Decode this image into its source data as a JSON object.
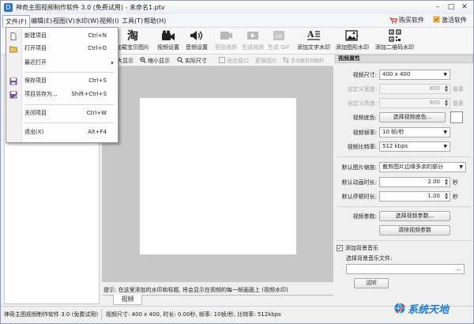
{
  "window": {
    "title": "神奇主图视频制作软件 3.0 (免费试用) - 未命名1.ptv",
    "controls": [
      "–",
      "□",
      "✕"
    ]
  },
  "menubar": {
    "items": [
      "文件(F)",
      "编辑(E)",
      "视图(V)",
      "水印(W)",
      "视频(I)",
      "工具(T)",
      "帮助(H)"
    ],
    "buy_label": "购买软件",
    "activate_label": "激活软件"
  },
  "toolbar": {
    "items": [
      {
        "label": "加载宝贝图片",
        "icon": "taobao-icon"
      },
      {
        "label": "视频设置",
        "icon": "video-camera-icon"
      },
      {
        "label": "音频设置",
        "icon": "speaker-icon"
      },
      {
        "label": "预览视频",
        "icon": "preview-video-icon"
      },
      {
        "label": "生成视频",
        "icon": "generate-video-icon"
      },
      {
        "label": "生成 GIF",
        "icon": "gif-icon"
      },
      {
        "label": "添加文字水印",
        "icon": "text-watermark-icon"
      },
      {
        "label": "添加图形水印",
        "icon": "image-watermark-icon"
      },
      {
        "label": "添加二维码水印",
        "icon": "qrcode-icon"
      }
    ]
  },
  "subtoolbar": {
    "items": [
      "放大显示",
      "缩小显示",
      "实际尺寸",
      "适合窗口",
      "更换图片",
      "手动裁剪和翻转"
    ]
  },
  "file_menu": {
    "items": [
      {
        "label": "新建项目",
        "shortcut": "Ctrl+N",
        "icon": "new-file-icon"
      },
      {
        "label": "打开项目",
        "shortcut": "Ctrl+O",
        "icon": "open-folder-icon"
      },
      {
        "label": "最近打开",
        "shortcut": "",
        "icon": "",
        "submenu": "▸"
      },
      {
        "label": "保存项目",
        "shortcut": "Ctrl+S",
        "icon": "save-icon"
      },
      {
        "label": "项目另存为...",
        "shortcut": "Shift+Ctrl+S",
        "icon": "save-as-icon"
      },
      {
        "label": "关闭项目",
        "shortcut": "Ctrl+W",
        "icon": ""
      },
      {
        "label": "退出(X)",
        "shortcut": "Alt+F4",
        "icon": ""
      }
    ]
  },
  "canvas": {
    "hint": "提示: 在这里添加的水印和标题, 将会显示在视频的每一帧画面上 (视频水印)",
    "tab": "视频"
  },
  "properties": {
    "header": "视频属性",
    "video_size": {
      "label": "视频尺寸:",
      "value": "400 x 400"
    },
    "custom_width": {
      "label": "自定义宽度:",
      "value": "800",
      "unit": "像素"
    },
    "custom_height": {
      "label": "自定义高度:",
      "value": "800",
      "unit": "像素"
    },
    "bg_color": {
      "label": "视频底色:",
      "button": "选择视频底色..."
    },
    "frame_rate": {
      "label": "视频帧率:",
      "value": "10 帧/秒"
    },
    "bitrate": {
      "label": "视频比特率:",
      "value": "512 kbps"
    },
    "image_scale": {
      "label": "默认图片缩放:",
      "value": "裁剪图片边缘多余的部分"
    },
    "anim_duration": {
      "label": "默认动画时长:",
      "value": "2.00",
      "unit": "秒"
    },
    "pause_duration": {
      "label": "默认停顿时长:",
      "value": "1.00",
      "unit": "秒"
    },
    "video_params": {
      "label": "视频参数:",
      "button": "选择视频参数...",
      "clear_button": "清除视频参数"
    },
    "music": {
      "checkbox": "添加背景音乐",
      "checked": true,
      "file_label": "选择背景音乐文件:",
      "browse": "...",
      "test_button": "试听"
    }
  },
  "status": {
    "left": "神奇主图视频制作软件 3.0 (免费试用)",
    "right": "视频尺寸: 400 x 400, 时长: 0.00秒, 帧率: 10帧/秒, 比特率: 512kbps"
  },
  "watermark": {
    "text": "系统天地"
  },
  "colors": {
    "accent": "#2a74c9",
    "canvas_bg": "#c7c7c7",
    "cart": "#d9342b"
  }
}
